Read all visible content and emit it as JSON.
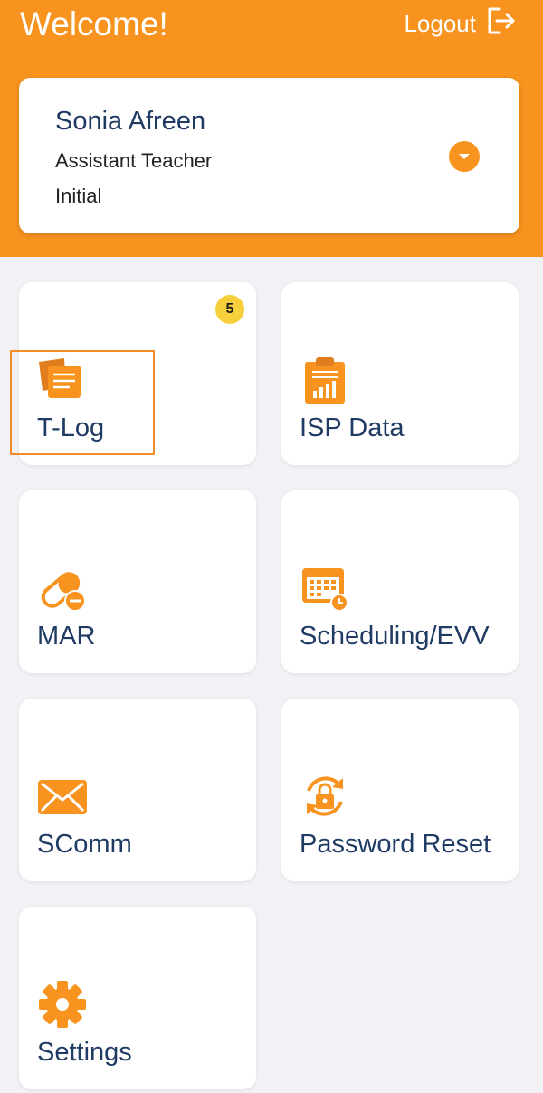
{
  "header": {
    "welcome": "Welcome!",
    "logout_label": "Logout"
  },
  "profile": {
    "name": "Sonia Afreen",
    "role": "Assistant Teacher",
    "level": "Initial"
  },
  "tiles": [
    {
      "label": "T-Log",
      "icon": "notes-icon",
      "badge": "5"
    },
    {
      "label": "ISP Data",
      "icon": "clipboard-chart-icon"
    },
    {
      "label": "MAR",
      "icon": "pill-icon"
    },
    {
      "label": "Scheduling/EVV",
      "icon": "calendar-clock-icon"
    },
    {
      "label": "SComm",
      "icon": "envelope-icon"
    },
    {
      "label": "Password Reset",
      "icon": "lock-refresh-icon"
    },
    {
      "label": "Settings",
      "icon": "gear-icon"
    }
  ],
  "colors": {
    "accent": "#f7931e",
    "text_primary": "#1f3b63",
    "badge": "#f6cf3b",
    "background": "#f1f1f6"
  }
}
